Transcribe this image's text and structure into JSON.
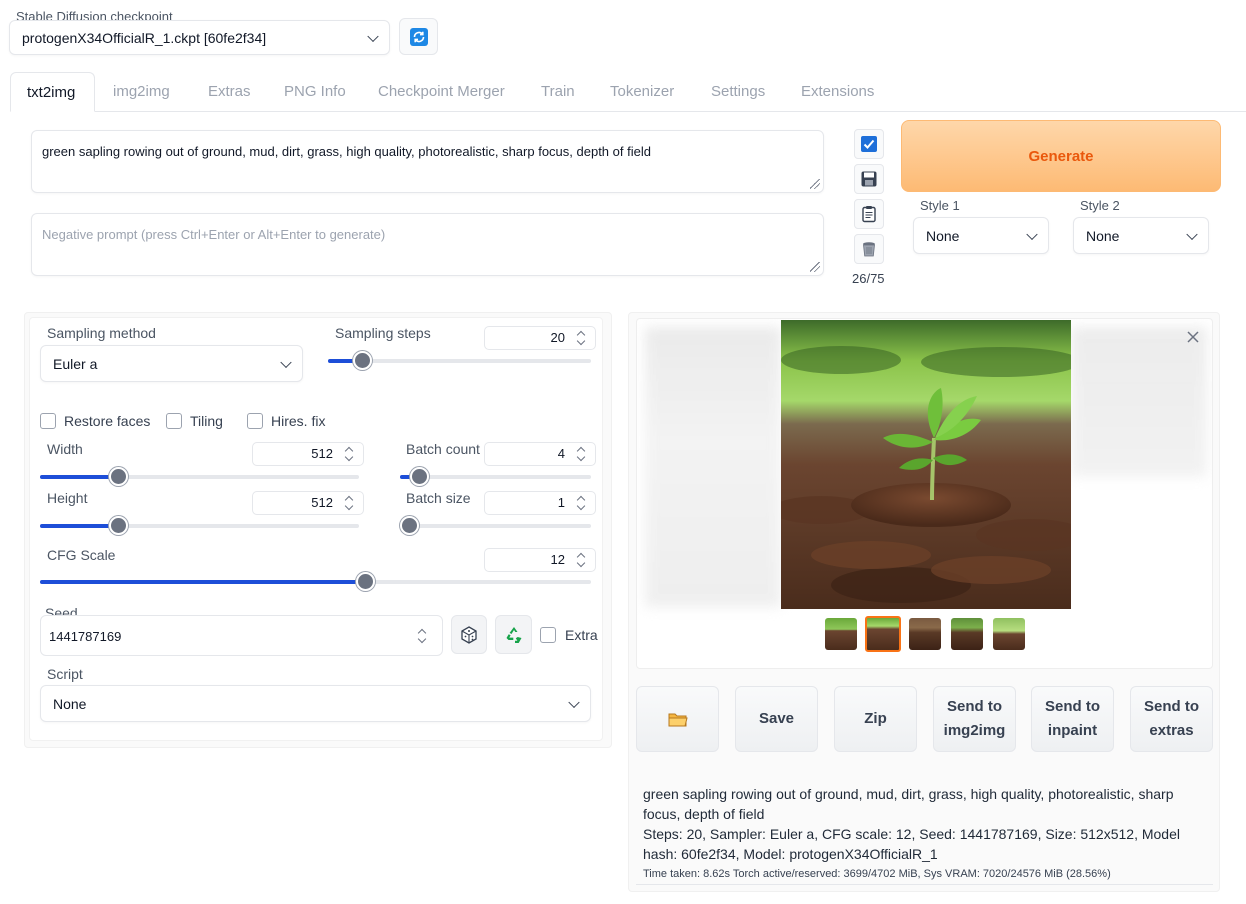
{
  "checkpoint": {
    "label": "Stable Diffusion checkpoint",
    "value": "protogenX34OfficialR_1.ckpt [60fe2f34]",
    "refresh_icon": "refresh-icon"
  },
  "tabs": [
    "txt2img",
    "img2img",
    "Extras",
    "PNG Info",
    "Checkpoint Merger",
    "Train",
    "Tokenizer",
    "Settings",
    "Extensions"
  ],
  "prompt": {
    "text": "green sapling rowing out of ground, mud, dirt, grass, high quality, photorealistic, sharp focus, depth of field",
    "negative_placeholder": "Negative prompt (press Ctrl+Enter or Alt+Enter to generate)",
    "token_count": "26/75"
  },
  "tools": {
    "icons": [
      "checkbox-icon",
      "save-icon",
      "clipboard-icon",
      "trash-icon"
    ]
  },
  "generate": {
    "label": "Generate",
    "color": "#f97316"
  },
  "styles": {
    "style1_label": "Style 1",
    "style1_value": "None",
    "style2_label": "Style 2",
    "style2_value": "None"
  },
  "params": {
    "sampling_method_label": "Sampling method",
    "sampling_method": "Euler a",
    "sampling_steps_label": "Sampling steps",
    "sampling_steps": "20",
    "sampling_steps_fraction": 0.13,
    "restore_faces": "Restore faces",
    "tiling": "Tiling",
    "hires_fix": "Hires. fix",
    "width_label": "Width",
    "width": "512",
    "width_fraction": 0.245,
    "height_label": "Height",
    "height": "512",
    "height_fraction": 0.245,
    "batch_count_label": "Batch count",
    "batch_count": "4",
    "batch_count_fraction": 0.1,
    "batch_size_label": "Batch size",
    "batch_size": "1",
    "batch_size_fraction": 0.0,
    "cfg_label": "CFG Scale",
    "cfg": "12",
    "cfg_fraction": 0.59,
    "seed_label": "Seed",
    "seed": "1441787169",
    "extra_label": "Extra",
    "script_label": "Script",
    "script": "None",
    "accent": "#1d4ed8"
  },
  "output": {
    "close_icon": "close-icon",
    "thumb_count": 5,
    "selected_thumb": 1,
    "buttons": {
      "folder_icon": "folder-icon",
      "save": "Save",
      "zip": "Zip",
      "send_img2img_1": "Send to",
      "send_img2img_2": "img2img",
      "send_inpaint_1": "Send to",
      "send_inpaint_2": "inpaint",
      "send_extras_1": "Send to",
      "send_extras_2": "extras"
    },
    "info_prompt": "green sapling rowing out of ground, mud, dirt, grass, high quality, photorealistic, sharp focus, depth of field",
    "info_params": "Steps: 20, Sampler: Euler a, CFG scale: 12, Seed: 1441787169, Size: 512x512, Model hash: 60fe2f34, Model: protogenX34OfficialR_1",
    "time_taken": "Time taken: 8.62s  Torch active/reserved: 3699/4702 MiB, Sys VRAM: 7020/24576 MiB (28.56%)"
  }
}
